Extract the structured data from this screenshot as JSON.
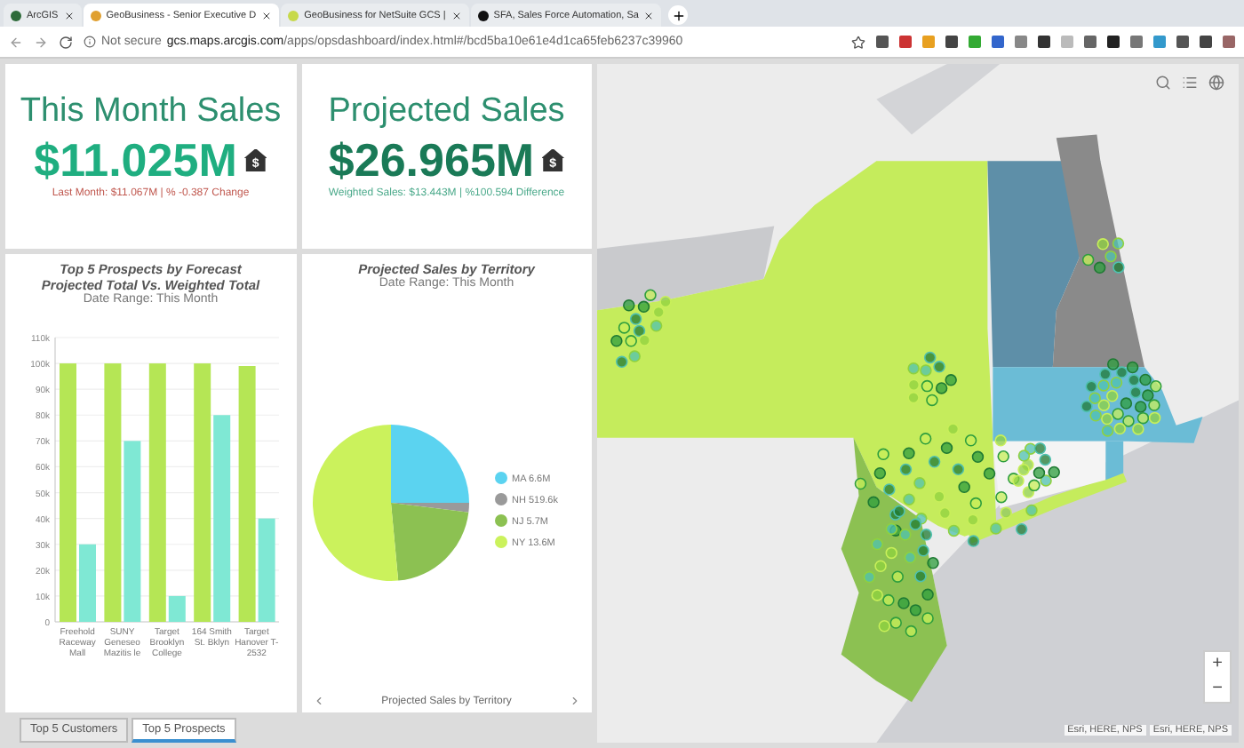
{
  "browser": {
    "tabs": [
      {
        "label": "ArcGIS",
        "selected": false
      },
      {
        "label": "GeoBusiness - Senior Executive D",
        "selected": true
      },
      {
        "label": "GeoBusiness for NetSuite GCS |",
        "selected": false
      },
      {
        "label": "SFA, Sales Force Automation, Sa",
        "selected": false
      }
    ],
    "security": "Not secure",
    "url_host": "gcs.maps.arcgis.com",
    "url_path": "/apps/opsdashboard/index.html#/bcd5ba10e61e4d1ca65feb6237c39960"
  },
  "kpis": [
    {
      "title": "This Month Sales",
      "value": "$11.025M",
      "icon_text": "$",
      "subtitle": "Last Month: $11.067M | % -0.387 Change",
      "kind": "current"
    },
    {
      "title": "Projected Sales",
      "value": "$26.965M",
      "icon_text": "$",
      "subtitle": "Weighted Sales: $13.443M | %100.594 Difference",
      "kind": "projected"
    }
  ],
  "bar_card": {
    "title_lines": [
      "Top 5 Prospects by Forecast",
      "Projected Total Vs. Weighted Total"
    ],
    "date_range": "Date Range: This Month",
    "chart_data": {
      "type": "bar",
      "categories": [
        "Freehold Raceway Mall",
        "SUNY Geneseo Mazitis le",
        "Target Brooklyn College",
        "164 Smith St. Bklyn",
        "Target Hanover T-2532"
      ],
      "series": [
        {
          "color": "#b5e655",
          "values": [
            100000,
            100000,
            100000,
            100000,
            99000
          ]
        },
        {
          "color": "#7fe8d4",
          "values": [
            30000,
            70000,
            10000,
            80000,
            40000
          ]
        }
      ],
      "ylim": [
        0,
        110000
      ],
      "grid": true,
      "yticks": [
        {
          "value": 0,
          "label": "0"
        },
        {
          "value": 10000,
          "label": "10k"
        },
        {
          "value": 20000,
          "label": "20k"
        },
        {
          "value": 30000,
          "label": "30k"
        },
        {
          "value": 40000,
          "label": "40k"
        },
        {
          "value": 50000,
          "label": "50k"
        },
        {
          "value": 60000,
          "label": "60k"
        },
        {
          "value": 70000,
          "label": "70k"
        },
        {
          "value": 80000,
          "label": "80k"
        },
        {
          "value": 90000,
          "label": "90k"
        },
        {
          "value": 100000,
          "label": "100k"
        },
        {
          "value": 110000,
          "label": "110k"
        }
      ]
    }
  },
  "pie_card": {
    "title": "Projected Sales by Territory",
    "date_range": "Date Range: This Month",
    "footer": "Projected Sales by Territory",
    "chart_data": {
      "type": "pie",
      "categories": [
        "MA 6.6M",
        "NH 519.6k",
        "NJ 5.7M",
        "NY 13.6M"
      ],
      "series": [
        {
          "values": [
            24.98,
            1.97,
            21.57,
            51.48
          ]
        }
      ],
      "colors": [
        "#5bd3f0",
        "#9a9a9a",
        "#8cc152",
        "#cbf25c"
      ],
      "legend": true
    }
  },
  "bottom_tabs": [
    {
      "label": "Top 5 Customers",
      "selected": false
    },
    {
      "label": "Top 5 Prospects",
      "selected": true
    }
  ],
  "map": {
    "attribution": [
      "Esri, HERE, NPS",
      "Esri, HERE, NPS"
    ],
    "zoom_in": "+",
    "zoom_out": "−"
  }
}
